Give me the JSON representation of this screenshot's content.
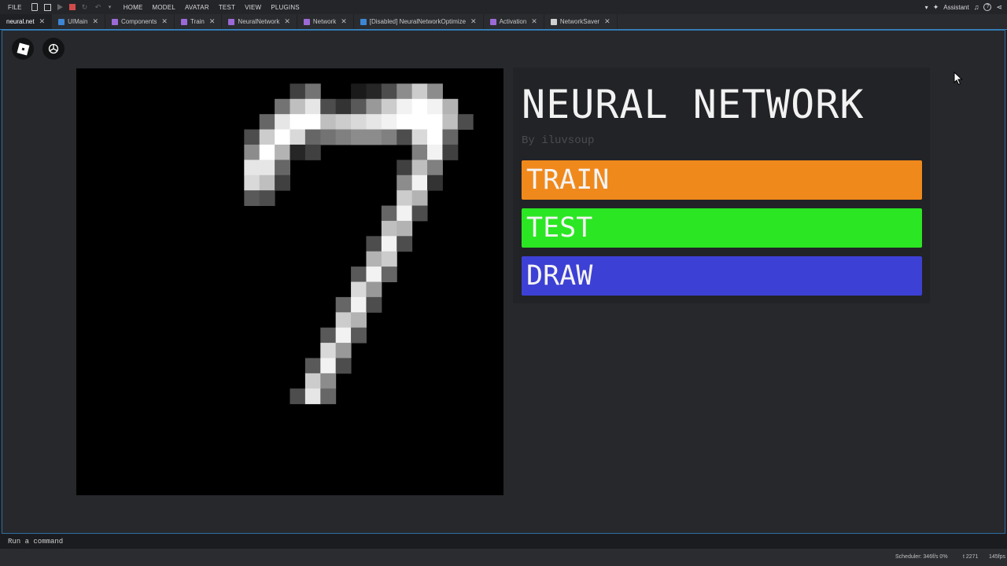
{
  "menubar": {
    "file": "FILE",
    "items": [
      "HOME",
      "MODEL",
      "AVATAR",
      "TEST",
      "VIEW",
      "PLUGINS"
    ],
    "assistant": "Assistant"
  },
  "tabs": [
    {
      "label": "neural.net",
      "color": "",
      "active": true
    },
    {
      "label": "UIMain",
      "color": "#3d86d4"
    },
    {
      "label": "Components",
      "color": "#9b6ad6"
    },
    {
      "label": "Train",
      "color": "#9b6ad6"
    },
    {
      "label": "NeuralNetwork",
      "color": "#9b6ad6"
    },
    {
      "label": "Network",
      "color": "#9b6ad6"
    },
    {
      "label": "[Disabled] NeuralNetworkOptimize",
      "color": "#3d86d4"
    },
    {
      "label": "Activation",
      "color": "#9b6ad6"
    },
    {
      "label": "NetworkSaver",
      "color": "#d0d0d0"
    }
  ],
  "app": {
    "title": "NEURAL NETWORK",
    "byline": "By iluvsoup",
    "buttons": {
      "train": {
        "label": "TRAIN",
        "color": "#f0891c"
      },
      "test": {
        "label": "TEST",
        "color": "#2be623"
      },
      "draw": {
        "label": "DRAW",
        "color": "#3d40d4"
      }
    }
  },
  "command": {
    "placeholder": "Run a command"
  },
  "status": {
    "scheduler": "Scheduler: 346f/s 0%",
    "t": "t 2271",
    "fps": "145fps"
  },
  "digit_grid": {
    "size": 28,
    "pixels": [
      [
        7,
        20,
        0.25
      ],
      [
        8,
        20,
        0.45
      ],
      [
        11,
        20,
        0.1
      ],
      [
        12,
        20,
        0.15
      ],
      [
        13,
        20,
        0.3
      ],
      [
        14,
        20,
        0.55
      ],
      [
        15,
        20,
        0.8
      ],
      [
        16,
        20,
        0.55
      ],
      [
        6,
        19,
        0.45
      ],
      [
        7,
        19,
        0.75
      ],
      [
        8,
        19,
        0.9
      ],
      [
        9,
        19,
        0.3
      ],
      [
        10,
        19,
        0.2
      ],
      [
        11,
        19,
        0.35
      ],
      [
        12,
        19,
        0.6
      ],
      [
        13,
        19,
        0.8
      ],
      [
        14,
        19,
        0.95
      ],
      [
        15,
        19,
        1
      ],
      [
        16,
        19,
        0.95
      ],
      [
        17,
        19,
        0.7
      ],
      [
        5,
        18,
        0.4
      ],
      [
        6,
        18,
        0.9
      ],
      [
        7,
        18,
        1
      ],
      [
        8,
        18,
        1
      ],
      [
        9,
        18,
        0.75
      ],
      [
        10,
        18,
        0.8
      ],
      [
        11,
        18,
        0.85
      ],
      [
        12,
        18,
        0.9
      ],
      [
        13,
        18,
        0.95
      ],
      [
        14,
        18,
        1
      ],
      [
        15,
        18,
        1
      ],
      [
        16,
        18,
        1
      ],
      [
        17,
        18,
        0.75
      ],
      [
        18,
        18,
        0.3
      ],
      [
        4,
        17,
        0.3
      ],
      [
        5,
        17,
        0.8
      ],
      [
        6,
        17,
        1
      ],
      [
        7,
        17,
        0.85
      ],
      [
        8,
        17,
        0.4
      ],
      [
        9,
        17,
        0.45
      ],
      [
        10,
        17,
        0.5
      ],
      [
        11,
        17,
        0.55
      ],
      [
        12,
        17,
        0.55
      ],
      [
        13,
        17,
        0.5
      ],
      [
        14,
        17,
        0.3
      ],
      [
        15,
        17,
        0.85
      ],
      [
        16,
        17,
        1
      ],
      [
        17,
        17,
        0.4
      ],
      [
        4,
        16,
        0.55
      ],
      [
        5,
        16,
        1
      ],
      [
        6,
        16,
        0.7
      ],
      [
        7,
        16,
        0.15
      ],
      [
        8,
        16,
        0.25
      ],
      [
        15,
        16,
        0.5
      ],
      [
        16,
        16,
        0.95
      ],
      [
        17,
        16,
        0.25
      ],
      [
        4,
        15,
        0.9
      ],
      [
        5,
        15,
        0.9
      ],
      [
        6,
        15,
        0.4
      ],
      [
        14,
        15,
        0.25
      ],
      [
        15,
        15,
        0.75
      ],
      [
        16,
        15,
        0.5
      ],
      [
        4,
        14,
        0.85
      ],
      [
        5,
        14,
        0.75
      ],
      [
        6,
        14,
        0.25
      ],
      [
        14,
        14,
        0.55
      ],
      [
        15,
        14,
        0.95
      ],
      [
        16,
        14,
        0.2
      ],
      [
        4,
        13,
        0.35
      ],
      [
        5,
        13,
        0.3
      ],
      [
        14,
        13,
        0.8
      ],
      [
        15,
        13,
        0.7
      ],
      [
        13,
        12,
        0.4
      ],
      [
        14,
        12,
        0.95
      ],
      [
        15,
        12,
        0.3
      ],
      [
        13,
        11,
        0.75
      ],
      [
        14,
        11,
        0.7
      ],
      [
        12,
        10,
        0.3
      ],
      [
        13,
        10,
        0.95
      ],
      [
        14,
        10,
        0.3
      ],
      [
        12,
        9,
        0.7
      ],
      [
        13,
        9,
        0.8
      ],
      [
        11,
        8,
        0.35
      ],
      [
        12,
        8,
        0.95
      ],
      [
        13,
        8,
        0.4
      ],
      [
        11,
        7,
        0.85
      ],
      [
        12,
        7,
        0.6
      ],
      [
        10,
        6,
        0.4
      ],
      [
        11,
        6,
        0.95
      ],
      [
        12,
        6,
        0.3
      ],
      [
        10,
        5,
        0.8
      ],
      [
        11,
        5,
        0.7
      ],
      [
        9,
        4,
        0.35
      ],
      [
        10,
        4,
        0.95
      ],
      [
        11,
        4,
        0.35
      ],
      [
        9,
        3,
        0.85
      ],
      [
        10,
        3,
        0.6
      ],
      [
        8,
        2,
        0.35
      ],
      [
        9,
        2,
        0.95
      ],
      [
        10,
        2,
        0.3
      ],
      [
        8,
        1,
        0.8
      ],
      [
        9,
        1,
        0.55
      ],
      [
        7,
        0,
        0.3
      ],
      [
        8,
        0,
        0.9
      ],
      [
        9,
        0,
        0.4
      ]
    ]
  }
}
